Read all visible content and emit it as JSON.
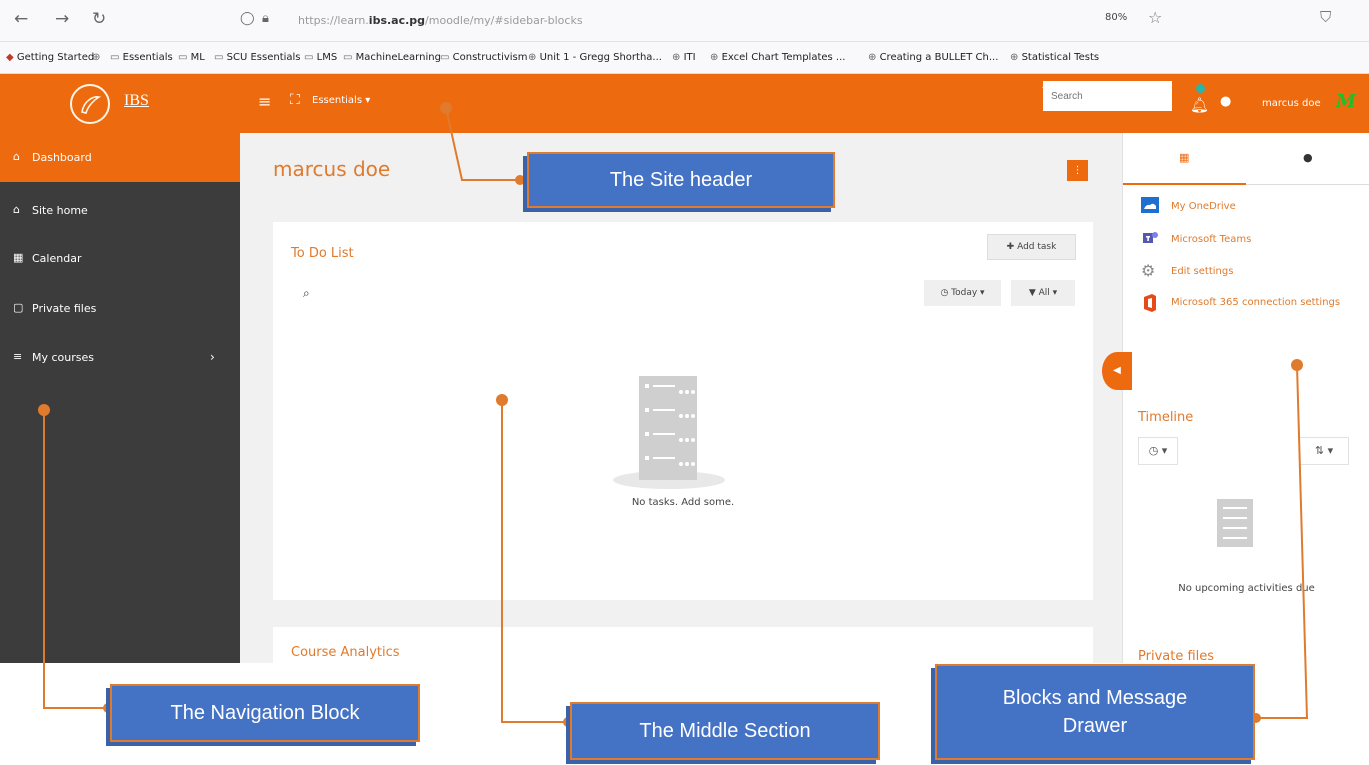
{
  "browser": {
    "back_icon": "←",
    "forward_icon": "→",
    "reload_icon": "↻",
    "url_prefix": "https://learn.",
    "url_domain": "ibs.ac.pg",
    "url_path": "/moodle/my/#sidebar-blocks",
    "zoom": "80%",
    "bookmarks": [
      "Getting Started",
      "Essentials",
      "ML",
      "SCU Essentials",
      "LMS",
      "MachineLearning",
      "Constructivism",
      "Unit 1 - Gregg Shortha...",
      "ITI",
      "Excel Chart Templates ...",
      "Creating a BULLET Ch...",
      "Statistical Tests"
    ]
  },
  "header": {
    "logo_text": "IBS",
    "menu": "Essentials ▾",
    "search_placeholder": "Search",
    "user_name": "marcus doe",
    "avatar_initials": "M"
  },
  "leftnav": {
    "items": [
      {
        "label": "Dashboard",
        "icon": "⌂"
      },
      {
        "label": "Site home",
        "icon": "⌂"
      },
      {
        "label": "Calendar",
        "icon": "▦"
      },
      {
        "label": "Private files",
        "icon": "▢"
      },
      {
        "label": "My courses",
        "icon": "≡"
      }
    ]
  },
  "main": {
    "page_title": "marcus doe",
    "todo": {
      "title": "To Do List",
      "add_task": "✚ Add task",
      "filter_today": "◷ Today ▾",
      "filter_all": "▼ All ▾",
      "empty": "No tasks. Add some."
    },
    "analytics_title": "Course Analytics"
  },
  "drawer": {
    "links": [
      "My OneDrive",
      "Microsoft Teams",
      "Edit settings",
      "Microsoft 365 connection settings"
    ],
    "timeline_title": "Timeline",
    "timeline_empty": "No upcoming activities due",
    "private_files_title": "Private files"
  },
  "callouts": {
    "site_header": "The Site header",
    "navigation_block": "The Navigation Block",
    "middle_section": "The Middle Section",
    "blocks_drawer_line1": "Blocks and Message",
    "blocks_drawer_line2": "Drawer"
  },
  "colors": {
    "brand_orange": "#ee6a0f",
    "nav_dark": "#3c3c3c",
    "callout_blue": "#4472c4",
    "callout_border": "#e07a2c"
  }
}
